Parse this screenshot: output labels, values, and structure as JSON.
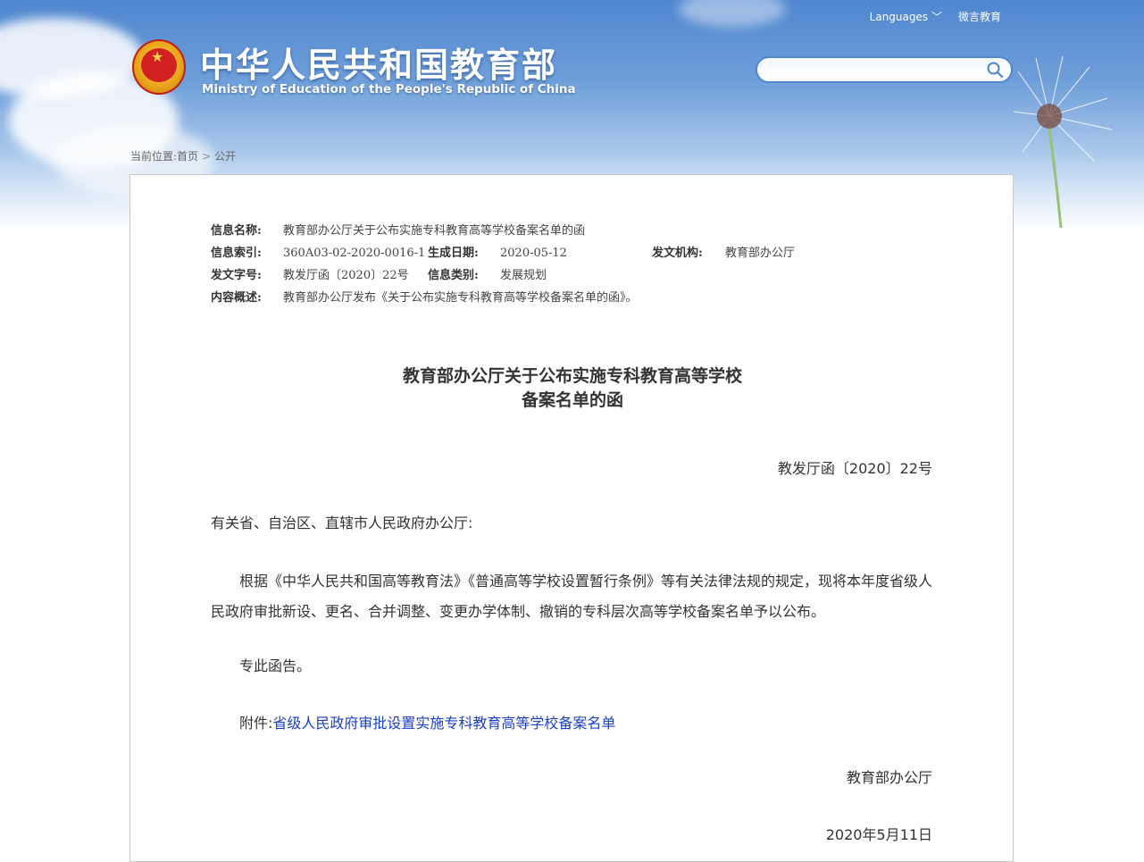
{
  "header": {
    "title_cn": "中华人民共和国教育部",
    "title_en": "Ministry of Education of the People's Republic of China",
    "languages_label": "Languages",
    "weiyan_label": "微言教育",
    "search_placeholder": ""
  },
  "breadcrumb": {
    "prefix": "当前位置:",
    "home": "首页",
    "current": "公开"
  },
  "meta": {
    "name_label": "信息名称:",
    "name_value": "教育部办公厅关于公布实施专科教育高等学校备案名单的函",
    "index_label": "信息索引:",
    "index_value": "360A03-02-2020-0016-1",
    "date_label": "生成日期:",
    "date_value": "2020-05-12",
    "org_label": "发文机构:",
    "org_value": "教育部办公厅",
    "doc_no_label": "发文字号:",
    "doc_no_value": "教发厅函〔2020〕22号",
    "category_label": "信息类别:",
    "category_value": "发展规划",
    "summary_label": "内容概述:",
    "summary_value": "教育部办公厅发布《关于公布实施专科教育高等学校备案名单的函》。"
  },
  "document": {
    "title_line1": "教育部办公厅关于公布实施专科教育高等学校",
    "title_line2": "备案名单的函",
    "number": "教发厅函〔2020〕22号",
    "addressee": "有关省、自治区、直辖市人民政府办公厅:",
    "main_paragraph": "根据《中华人民共和国高等教育法》《普通高等学校设置暂行条例》等有关法律法规的规定，现将本年度省级人民政府审批新设、更名、合并调整、变更办学体制、撤销的专科层次高等学校备案名单予以公布。",
    "closing": "专此函告。",
    "attachment_label": "附件:",
    "attachment_link": "省级人民政府审批设置实施专科教育高等学校备案名单",
    "signature_org": "教育部办公厅",
    "signature_date": "2020年5月11日"
  }
}
